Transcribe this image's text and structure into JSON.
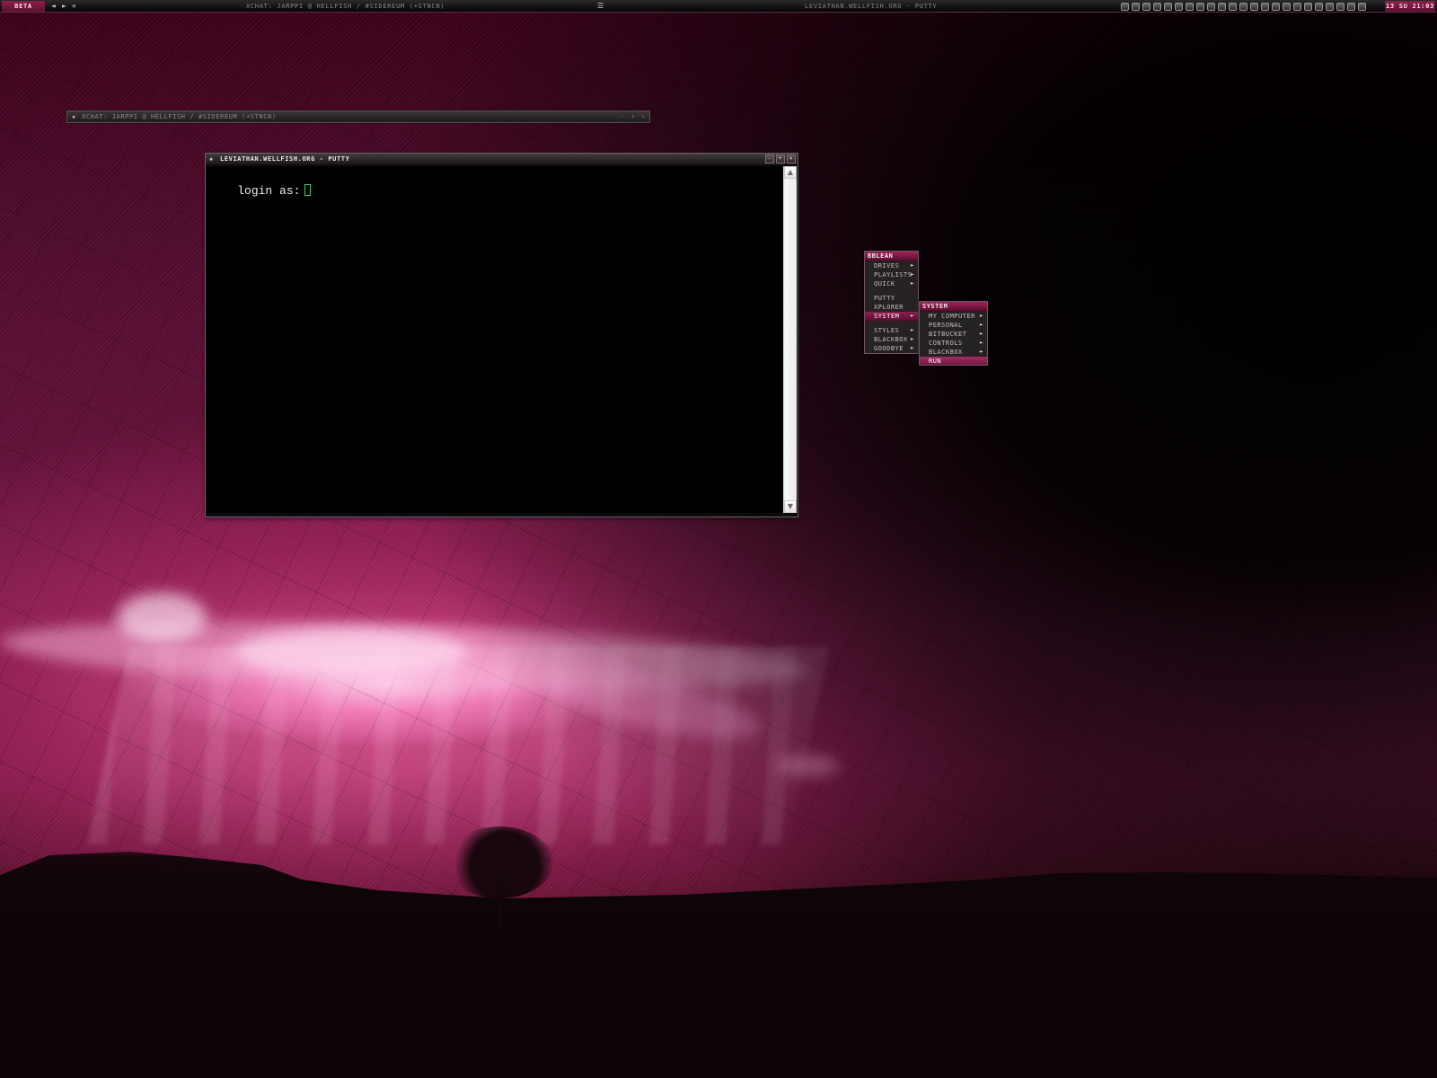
{
  "desktop": {
    "name": "pink sunset wallpaper"
  },
  "taskbar": {
    "beta_label": "BETA",
    "left_icons": {
      "prev": "◄",
      "next": "►",
      "tool": "✳"
    },
    "left_window_title": "XCHAT: JARPPI @ HELLFISH / #SIDEREUM (+STNCN)",
    "center_icon": "☰",
    "right_window_title": "LEVIATHAN.WELLFISH.ORG - PUTTY",
    "clock": "13 SU 21:03"
  },
  "xchat_window": {
    "title": "XCHAT: JARPPI @ HELLFISH / #SIDEREUM (+STNCN)",
    "controls": [
      "-",
      "+",
      "×"
    ]
  },
  "putty_window": {
    "system_icon": "▪",
    "title": "LEVIATHAN.WELLFISH.ORG - PUTTY",
    "controls": [
      "-",
      "+",
      "×"
    ],
    "terminal": {
      "prompt": "login as:"
    }
  },
  "menus": {
    "bblean": {
      "title": "BBLEAN",
      "items": [
        {
          "label": "DRIVES"
        },
        {
          "label": "PLAYLISTS"
        },
        {
          "label": "QUICK"
        },
        {
          "label": "PUTTY"
        },
        {
          "label": "XPLORER"
        },
        {
          "label": "SYSTEM"
        },
        {
          "label": "STYLES"
        },
        {
          "label": "BLACKBOX"
        },
        {
          "label": "GOODBYE"
        }
      ]
    },
    "system": {
      "title": "SYSTEM",
      "items": [
        {
          "label": "MY COMPUTER"
        },
        {
          "label": "PERSONAL"
        },
        {
          "label": "BITBUCKET"
        },
        {
          "label": "CONTROLS"
        },
        {
          "label": "BLACKBOX"
        },
        {
          "label": "RUN"
        }
      ]
    }
  },
  "icons": {
    "arrow_right": "►",
    "scroll_up": "▲",
    "scroll_down": "▼"
  },
  "colors": {
    "accent": "#8d214e",
    "cursor": "#42d24f"
  }
}
